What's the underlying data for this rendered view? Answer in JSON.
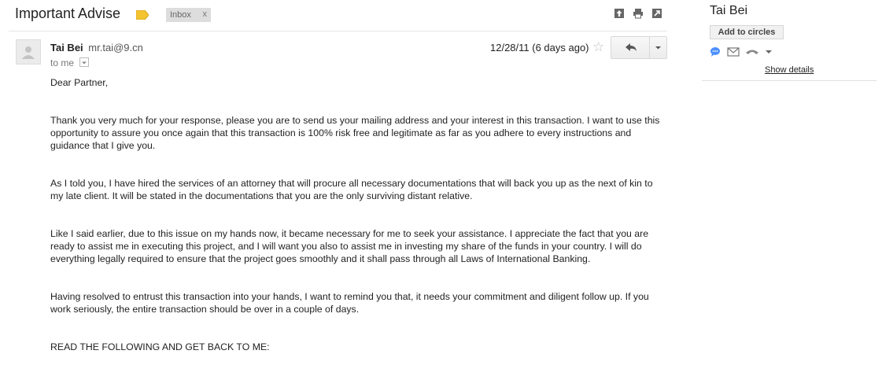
{
  "subject": "Important Advise",
  "label": {
    "name": "Inbox",
    "close": "x"
  },
  "message": {
    "sender_name": "Tai Bei",
    "sender_email": "mr.tai@9.cn",
    "recipient": "to me",
    "date": "12/28/11 (6 days ago)",
    "paragraphs": [
      "Dear Partner,",
      "Thank you very much for your response, please you are to send us your mailing address and your interest in this transaction. I want to use this opportunity to assure you once again that this transaction is 100% risk free and legitimate as far as you adhere to every instructions and guidance that I give you.",
      "As I told you, I have hired the services of an attorney that will procure all necessary documentations that will back you up as the next of kin to my late client. It will be stated in the documentations that you are the only surviving distant relative.",
      "Like I said earlier, due to this issue on my hands now, it became necessary for me to seek your assistance. I appreciate the fact that you are ready to assist me in executing this project, and I will want you also to assist me in investing my share of the funds in your country. I will do everything legally required to ensure that the project goes smoothly and it shall pass through all Laws of International Banking.",
      "Having resolved to entrust this transaction into your hands, I want to remind you that, it needs your commitment and diligent follow up. If you work seriously, the entire transaction should be over in a couple of days.",
      "READ THE FOLLOWING AND GET BACK TO ME:"
    ]
  },
  "sidebar": {
    "contact_name": "Tai Bei",
    "add_to_circles": "Add to circles",
    "show_details": "Show details"
  },
  "icons": [
    "label-tag-icon",
    "archive-icon",
    "print-icon",
    "new-window-icon",
    "star-icon",
    "reply-icon",
    "chevron-down-icon",
    "chat-icon",
    "mail-icon",
    "phone-icon",
    "avatar-icon"
  ],
  "colors": {
    "label_tag": "#f4c430",
    "chip_bg": "#dddddd",
    "chat_blue": "#4d90fe"
  }
}
